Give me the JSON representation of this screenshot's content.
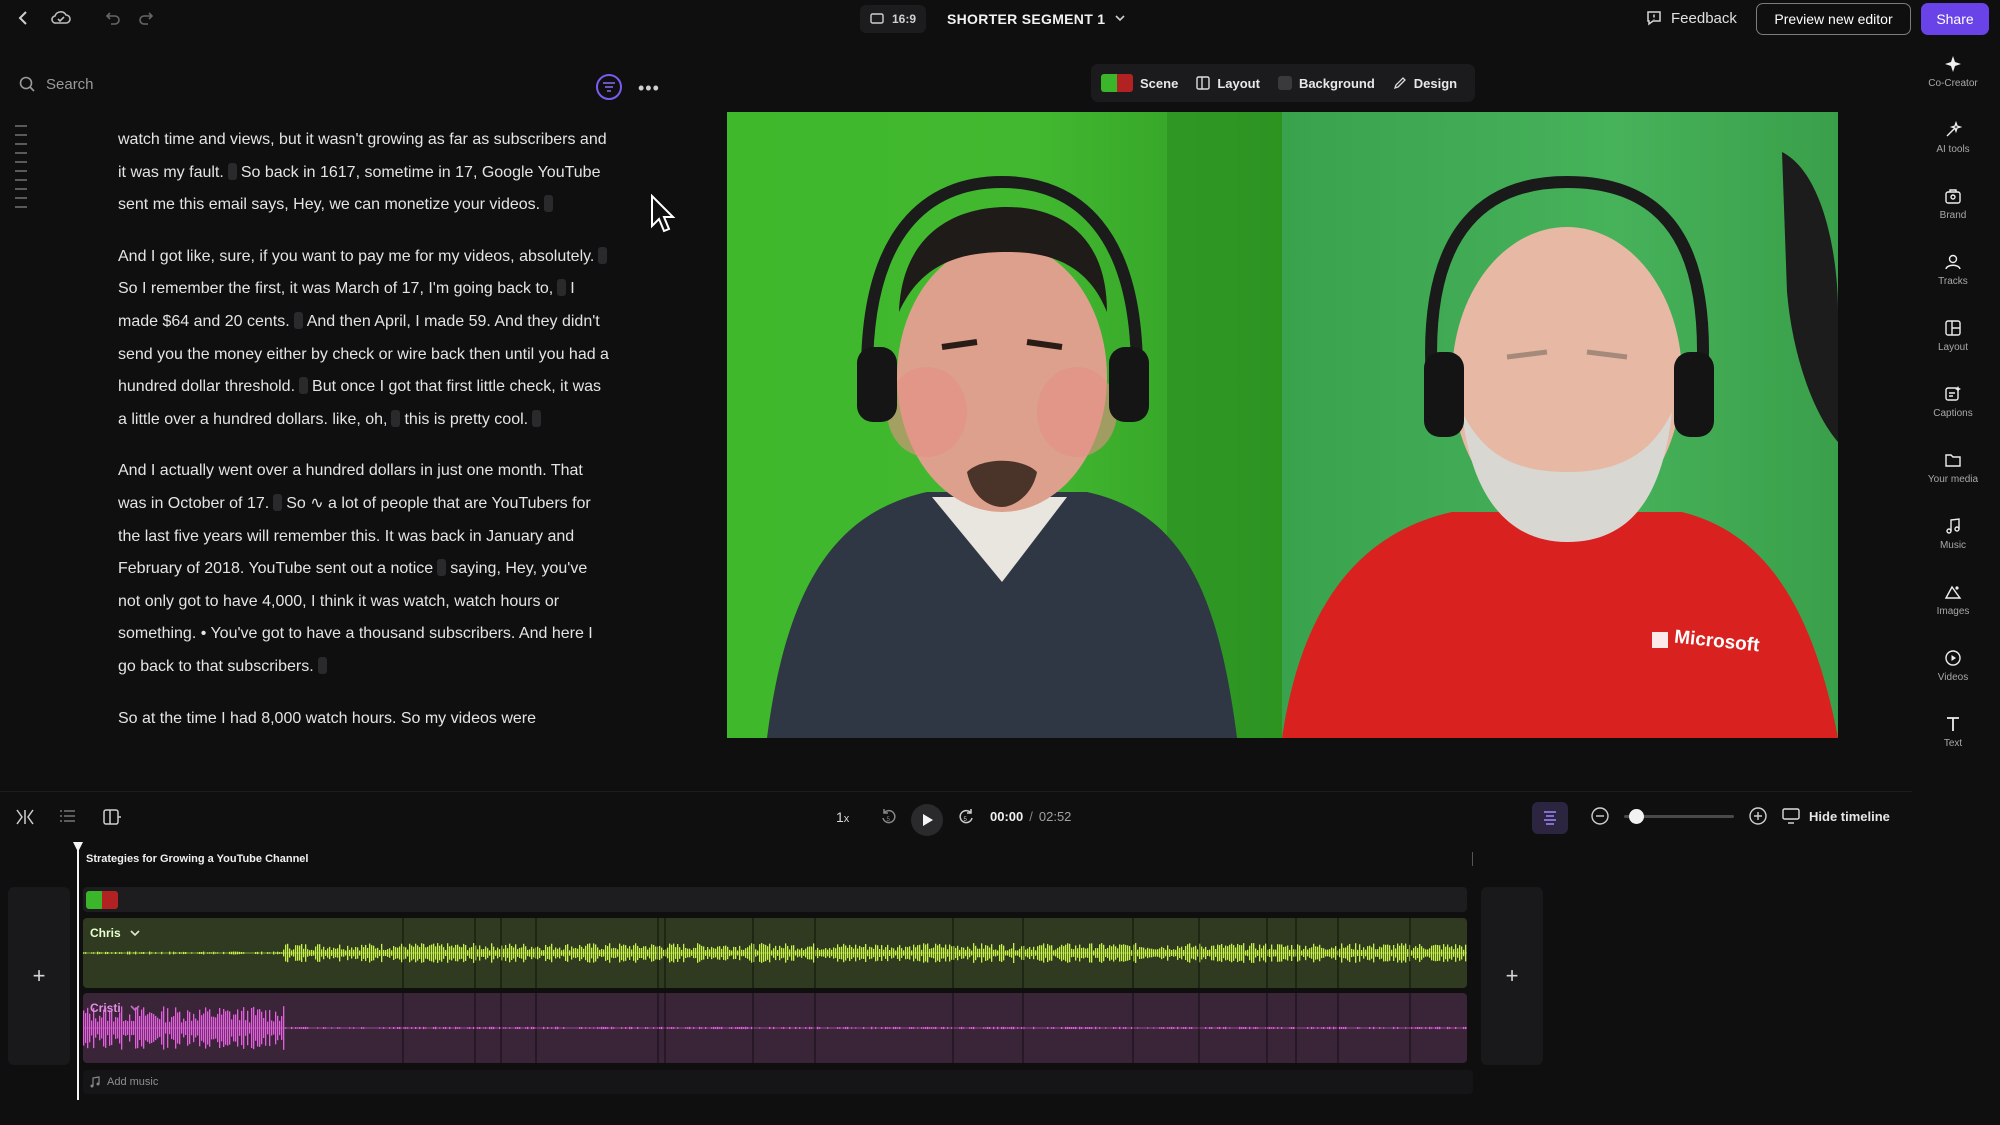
{
  "header": {
    "aspect_ratio": "16:9",
    "project_title": "SHORTER SEGMENT 1",
    "feedback_label": "Feedback",
    "preview_label": "Preview new editor",
    "share_label": "Share"
  },
  "transcript": {
    "search_placeholder": "Search",
    "paragraphs": [
      [
        "watch time and views, but it wasn't growing as far as subscribers and it was my fault.",
        "So back in 1617, sometime in 17, Google YouTube sent me this email says, Hey, we can monetize your videos."
      ],
      [
        "And I got like, sure, if you want to pay me for my videos, absolutely.",
        "So I remember the first, it was March of 17, I'm going back to,",
        "I made $64 and 20 cents.",
        "And then April, I made 59. And they didn't send you the money either by check or wire back then until you had a hundred dollar threshold.",
        "But once I got that first little check, it was a little over a hundred dollars. like, oh,",
        "this is pretty cool."
      ],
      [
        "And I actually went over a hundred dollars in just one month. That was in October of 17.",
        "So ∿ a lot of people that are YouTubers for the last five years will remember this. It was back in January and February of 2018. YouTube sent out a notice",
        "saying, Hey, you've not only got to have 4,000, I think it was watch, watch hours or something. • You've got to have a thousand subscribers. And here I go back to that subscribers."
      ],
      [
        "So at the time I had 8,000 watch hours. So my videos were"
      ]
    ]
  },
  "preview_toolbar": {
    "scene_label": "Scene",
    "layout_label": "Layout",
    "background_label": "Background",
    "design_label": "Design"
  },
  "video": {
    "shirt_text": "Microsoft"
  },
  "right_rail": [
    {
      "label": "Co-Creator",
      "icon": "sparkle-icon"
    },
    {
      "label": "AI tools",
      "icon": "ai-tools-icon"
    },
    {
      "label": "Brand",
      "icon": "brand-icon"
    },
    {
      "label": "Tracks",
      "icon": "tracks-icon"
    },
    {
      "label": "Layout",
      "icon": "layout-icon"
    },
    {
      "label": "Captions",
      "icon": "captions-icon"
    },
    {
      "label": "Your media",
      "icon": "folder-icon"
    },
    {
      "label": "Music",
      "icon": "music-icon"
    },
    {
      "label": "Images",
      "icon": "images-icon"
    },
    {
      "label": "Videos",
      "icon": "videos-icon"
    },
    {
      "label": "Text",
      "icon": "text-icon"
    }
  ],
  "player": {
    "speed_label": "1",
    "speed_suffix": "x",
    "current_time": "00:00",
    "separator": "/",
    "duration": "02:52",
    "hide_timeline_label": "Hide timeline",
    "zoom_level": 0.05
  },
  "timeline": {
    "composition_title": "Strategies for Growing a YouTube Channel",
    "tracks": [
      {
        "name": "Chris",
        "color": "#c6f24a"
      },
      {
        "name": "Cristi",
        "color": "#e45ee0"
      }
    ],
    "add_music_label": "Add music",
    "add_label": "+"
  },
  "colors": {
    "accent": "#6a43e8",
    "chris_wave": "#c6f24a",
    "cristi_wave": "#e45ee0"
  }
}
